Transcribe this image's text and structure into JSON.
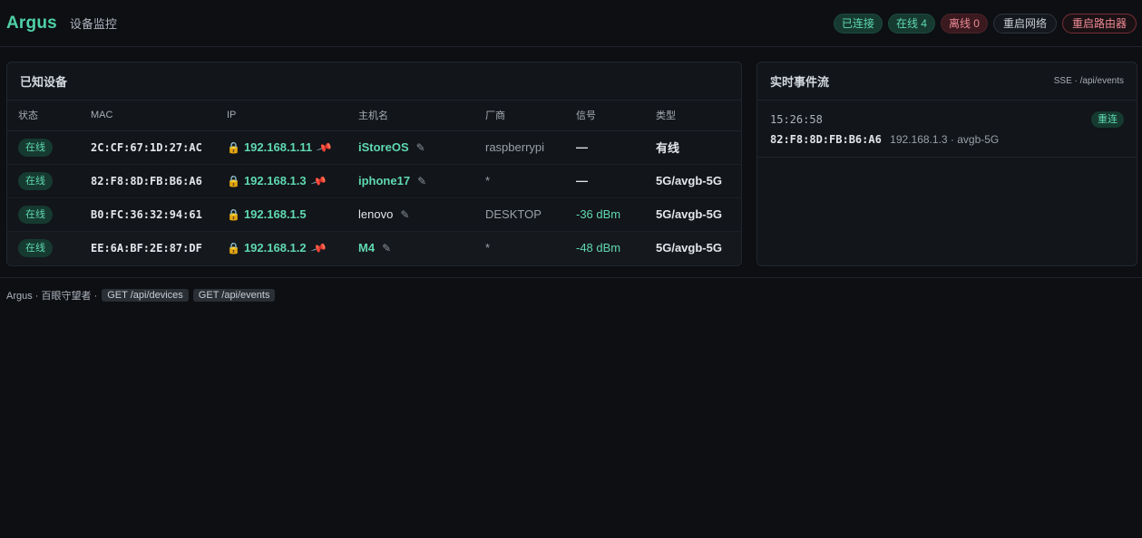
{
  "header": {
    "brand": "Argus",
    "subtitle": "设备监控",
    "status_connected": "已连接",
    "status_online": "在线 4",
    "status_offline": "离线 0",
    "restart_network_label": "重启网络",
    "restart_router_label": "重启路由器"
  },
  "devices_panel": {
    "title": "已知设备",
    "columns": [
      "状态",
      "MAC",
      "IP",
      "主机名",
      "厂商",
      "信号",
      "类型"
    ],
    "rows": [
      {
        "status": "在线",
        "mac": "2C:CF:67:1D:27:AC",
        "ip": "192.168.1.11",
        "hostname": "iStoreOS",
        "vendor": "raspberrypi",
        "signal": "—",
        "type": "有线"
      },
      {
        "status": "在线",
        "mac": "82:F8:8D:FB:B6:A6",
        "ip": "192.168.1.3",
        "hostname": "iphone17",
        "vendor": "*",
        "signal": "—",
        "type": "5G/avgb-5G"
      },
      {
        "status": "在线",
        "mac": "B0:FC:36:32:94:61",
        "ip": "192.168.1.5",
        "hostname": "lenovo",
        "vendor": "DESKTOP",
        "signal": "-36 dBm",
        "type": "5G/avgb-5G"
      },
      {
        "status": "在线",
        "mac": "EE:6A:BF:2E:87:DF",
        "ip": "192.168.1.2",
        "hostname": "M4",
        "vendor": "*",
        "signal": "-48 dBm",
        "type": "5G/avgb-5G"
      }
    ]
  },
  "events_panel": {
    "title": "实时事件流",
    "meta": "SSE · /api/events",
    "events": [
      {
        "time": "15:26:58",
        "tag": "重连",
        "mac": "82:F8:8D:FB:B6:A6",
        "detail": "192.168.1.3 · avgb-5G"
      }
    ]
  },
  "footer": {
    "text": "Argus · 百眼守望者 ·",
    "endpoint_devices": "GET /api/devices",
    "endpoint_events": "GET /api/events"
  },
  "colors": {
    "accent": "#4fd1a5",
    "danger": "#f08a95",
    "background": "#0d0f13"
  },
  "icons": {
    "lock": "lock-icon",
    "pin": "pin-icon",
    "edit": "pencil-icon"
  }
}
